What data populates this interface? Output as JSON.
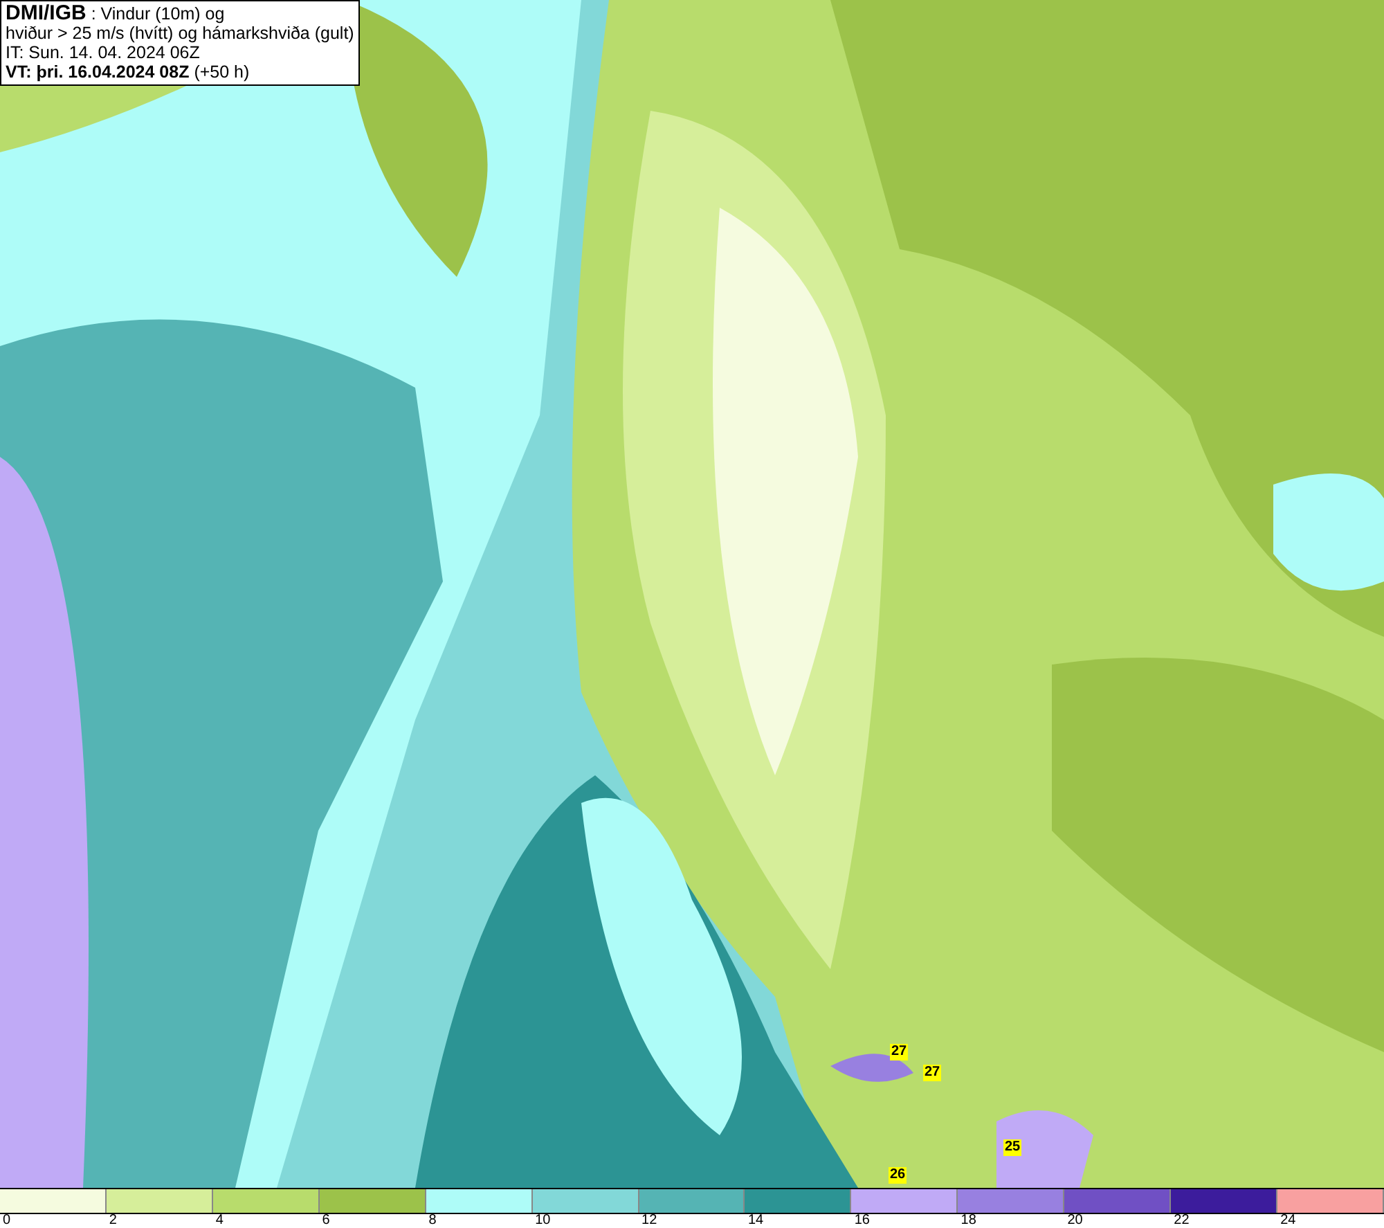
{
  "title_box": {
    "source": "DMI/IGB",
    "title_rest": " : Vindur (10m) og",
    "line_2": "hviður > 25 m/s (hvítt) og hámarkshviða (gult)",
    "issue_time": "IT: Sun. 14. 04. 2024 06Z",
    "valid_time": "VT: þri. 16.04.2024 08Z",
    "lead_time": " (+50 h)"
  },
  "gust_labels": [
    "27",
    "27",
    "25",
    "26"
  ],
  "legend": [
    {
      "color": "#f5fbdf",
      "label": "0"
    },
    {
      "color": "#d6ee9a",
      "label": "2"
    },
    {
      "color": "#b8dc6c",
      "label": "4"
    },
    {
      "color": "#9cc24a",
      "label": "6"
    },
    {
      "color": "#aefcf8",
      "label": "8"
    },
    {
      "color": "#82d8d8",
      "label": "10"
    },
    {
      "color": "#55b4b4",
      "label": "12"
    },
    {
      "color": "#2c9494",
      "label": "14"
    },
    {
      "color": "#c0aaf6",
      "label": "16"
    },
    {
      "color": "#9880e0",
      "label": "18"
    },
    {
      "color": "#7050c4",
      "label": "20"
    },
    {
      "color": "#3c1c9c",
      "label": "22"
    },
    {
      "color": "#f8a0a0",
      "label": "24"
    }
  ]
}
